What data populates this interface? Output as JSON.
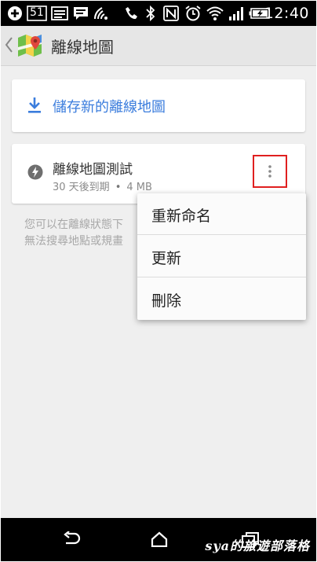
{
  "status_bar": {
    "time": "12:40",
    "notification_count": "51",
    "icons": [
      "add-icon",
      "message-count-icon",
      "image-icon",
      "chat-icon",
      "wifi-calling-icon",
      "do-not-disturb-icon",
      "bluetooth-icon",
      "nfc-icon",
      "alarm-icon",
      "wifi-icon",
      "signal-icon",
      "battery-charging-icon"
    ]
  },
  "app_bar": {
    "title": "離線地圖",
    "icons": [
      "back-chevron-icon",
      "google-maps-icon"
    ]
  },
  "save_card": {
    "label": "儲存新的離線地圖",
    "icon": "download-icon",
    "accent": "#3b7ddd"
  },
  "map_card": {
    "name": "離線地圖測試",
    "expiry": "30 天後到期",
    "separator": "•",
    "size": "4 MB",
    "icon": "bolt-icon",
    "menu_icon": "more-vert-icon",
    "highlight_color": "#e02020"
  },
  "info_text": {
    "line1": "您可以在離線狀態下",
    "line2": "無法搜尋地點或規畫"
  },
  "menu": {
    "items": [
      "重新命名",
      "更新",
      "刪除"
    ]
  },
  "nav_bar": {
    "icons": [
      "back-icon",
      "home-icon",
      "recent-apps-icon"
    ]
  },
  "watermark": "sya的旅遊部落格"
}
